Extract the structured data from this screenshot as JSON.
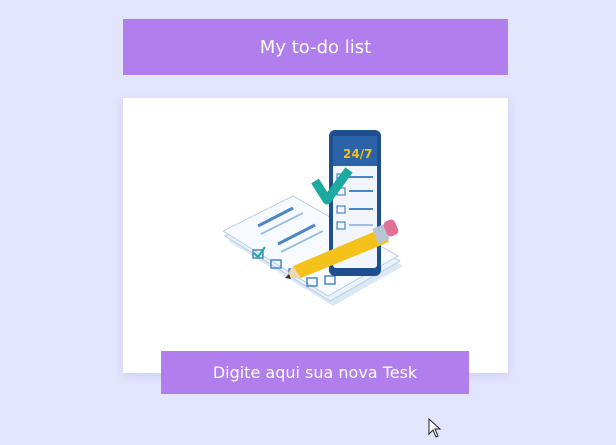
{
  "header": {
    "title": "My to-do list"
  },
  "illustration": {
    "icon": "todo-checklist-illustration",
    "phone_label": "24/7"
  },
  "new_task": {
    "label": "Digite aqui sua nova Tesk"
  },
  "colors": {
    "background": "#e3e4fd",
    "accent": "#b07fed",
    "card": "#ffffff"
  }
}
